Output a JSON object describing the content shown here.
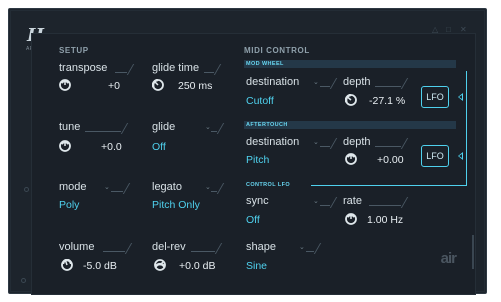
{
  "logo": {
    "mark": "H",
    "sub": "ARTS"
  },
  "setup": {
    "title": "SETUP",
    "transpose": {
      "label": "transpose",
      "value": "+0"
    },
    "tune": {
      "label": "tune",
      "value": "+0.0"
    },
    "mode": {
      "label": "mode",
      "value": "Poly"
    },
    "volume": {
      "label": "volume",
      "value": "-5.0 dB"
    },
    "glide_time": {
      "label": "glide time",
      "value": "250 ms"
    },
    "glide": {
      "label": "glide",
      "value": "Off"
    },
    "legato": {
      "label": "legato",
      "value": "Pitch Only"
    },
    "del_rev": {
      "label": "del-rev",
      "value": "+0.0 dB"
    }
  },
  "midi": {
    "title": "MIDI CONTROL",
    "mod_wheel": {
      "tag": "MOD WHEEL",
      "destination_label": "destination",
      "destination_value": "Cutoff",
      "depth_label": "depth",
      "depth_value": "-27.1 %",
      "lfo_label": "LFO"
    },
    "aftertouch": {
      "tag": "AFTERTOUCH",
      "destination_label": "destination",
      "destination_value": "Pitch",
      "depth_label": "depth",
      "depth_value": "+0.00",
      "lfo_label": "LFO"
    },
    "control_lfo": {
      "tag": "CONTROL LFO",
      "sync_label": "sync",
      "sync_value": "Off",
      "rate_label": "rate",
      "rate_value": "1.00 Hz",
      "shape_label": "shape",
      "shape_value": "Sine"
    }
  },
  "brand": "air",
  "colors": {
    "accent": "#4fd1ee",
    "background": "#1a2028",
    "text": "#d8e1e6"
  },
  "icons": {
    "knob": "knob-icon",
    "dropdown": "chevron-down-icon",
    "lfo_link": "arrow-left-icon"
  }
}
